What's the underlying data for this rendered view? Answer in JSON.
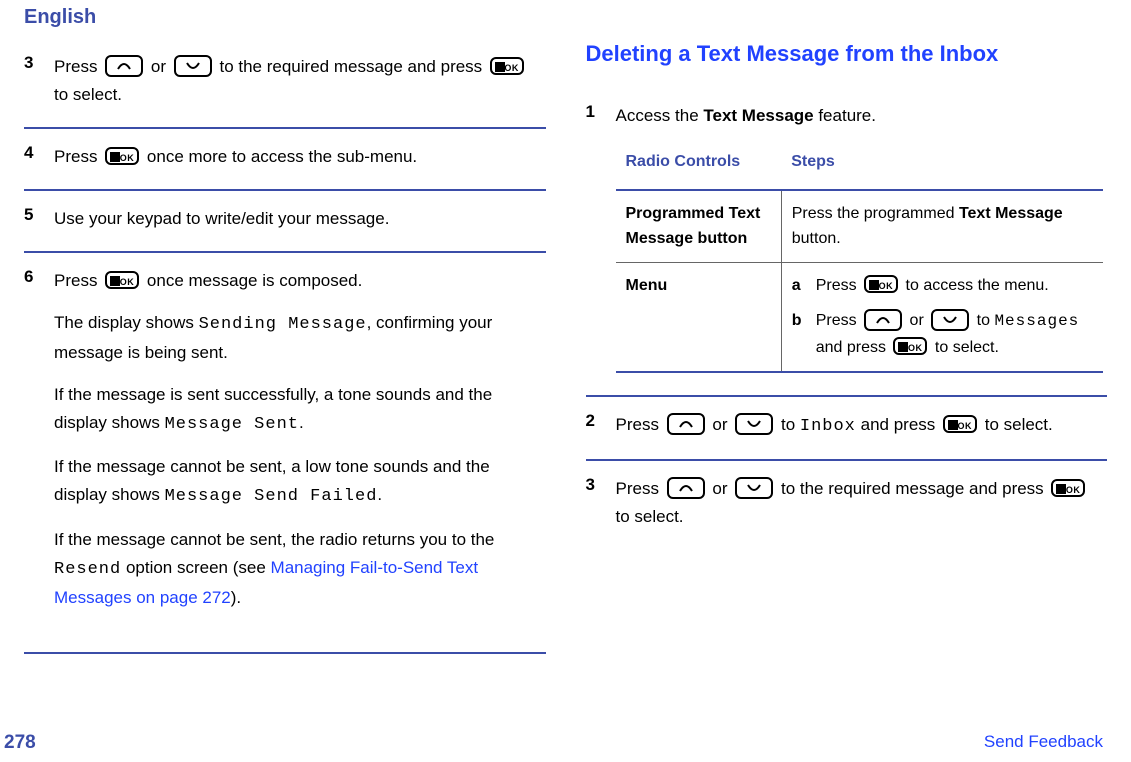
{
  "header_language": "English",
  "icon_ok_label": "OK",
  "left": {
    "steps": [
      {
        "num": "3",
        "paras": [
          {
            "segments": [
              {
                "t": "Press "
              },
              {
                "icon": "up"
              },
              {
                "t": " or "
              },
              {
                "icon": "down"
              },
              {
                "t": " to the required message and press "
              },
              {
                "icon": "ok"
              },
              {
                "t": " to select."
              }
            ]
          }
        ]
      },
      {
        "num": "4",
        "paras": [
          {
            "segments": [
              {
                "t": "Press "
              },
              {
                "icon": "ok"
              },
              {
                "t": " once more to access the sub-menu."
              }
            ]
          }
        ]
      },
      {
        "num": "5",
        "paras": [
          {
            "segments": [
              {
                "t": "Use your keypad to write/edit your message."
              }
            ]
          }
        ]
      },
      {
        "num": "6",
        "paras": [
          {
            "segments": [
              {
                "t": "Press "
              },
              {
                "icon": "ok"
              },
              {
                "t": " once message is composed."
              }
            ]
          },
          {
            "segments": [
              {
                "t": "The display shows "
              },
              {
                "mono": "Sending Message"
              },
              {
                "t": ", confirming your message is being sent."
              }
            ]
          },
          {
            "segments": [
              {
                "t": "If the message is sent successfully, a tone sounds and the display shows "
              },
              {
                "mono": "Message Sent"
              },
              {
                "t": "."
              }
            ]
          },
          {
            "segments": [
              {
                "t": "If the message cannot be sent, a low tone sounds and the display shows "
              },
              {
                "mono": "Message Send Failed"
              },
              {
                "t": "."
              }
            ]
          },
          {
            "segments": [
              {
                "t": "If the message cannot be sent, the radio returns you to the "
              },
              {
                "mono": "Resend"
              },
              {
                "t": " option screen (see "
              },
              {
                "link": "Managing Fail-to-Send Text Messages on page 272"
              },
              {
                "t": ")."
              }
            ]
          }
        ]
      }
    ]
  },
  "right": {
    "heading": "Deleting a Text Message from the Inbox",
    "steps": [
      {
        "num": "1",
        "intro": {
          "segments": [
            {
              "t": "Access the "
            },
            {
              "bold": "Text Message"
            },
            {
              "t": " feature."
            }
          ]
        },
        "table": {
          "headers": [
            "Radio Con­trols",
            "Steps"
          ],
          "rows": [
            {
              "label": "Programmed Text Mes­sage button",
              "content": [
                {
                  "segments": [
                    {
                      "t": "Press the programmed "
                    },
                    {
                      "bold": "Text Message"
                    },
                    {
                      "t": " button."
                    }
                  ]
                }
              ]
            },
            {
              "label": "Menu",
              "sublist": [
                {
                  "letter": "a",
                  "segments": [
                    {
                      "t": "Press "
                    },
                    {
                      "icon": "ok"
                    },
                    {
                      "t": " to access the menu."
                    }
                  ]
                },
                {
                  "letter": "b",
                  "segments": [
                    {
                      "t": "Press "
                    },
                    {
                      "icon": "up"
                    },
                    {
                      "t": " or "
                    },
                    {
                      "icon": "down"
                    },
                    {
                      "t": " to "
                    },
                    {
                      "mono": "Messages"
                    },
                    {
                      "t": " and press "
                    },
                    {
                      "icon": "ok"
                    },
                    {
                      "t": " to select."
                    }
                  ]
                }
              ]
            }
          ]
        }
      },
      {
        "num": "2",
        "paras": [
          {
            "segments": [
              {
                "t": "Press "
              },
              {
                "icon": "up"
              },
              {
                "t": " or "
              },
              {
                "icon": "down"
              },
              {
                "t": " to "
              },
              {
                "mono": "Inbox"
              },
              {
                "t": " and press "
              },
              {
                "icon": "ok"
              },
              {
                "t": " to select."
              }
            ]
          }
        ]
      },
      {
        "num": "3",
        "paras": [
          {
            "segments": [
              {
                "t": "Press "
              },
              {
                "icon": "up"
              },
              {
                "t": " or "
              },
              {
                "icon": "down"
              },
              {
                "t": " to the required message and press "
              },
              {
                "icon": "ok"
              },
              {
                "t": " to select."
              }
            ]
          }
        ]
      }
    ]
  },
  "footer": {
    "page": "278",
    "feedback": "Send Feedback"
  }
}
